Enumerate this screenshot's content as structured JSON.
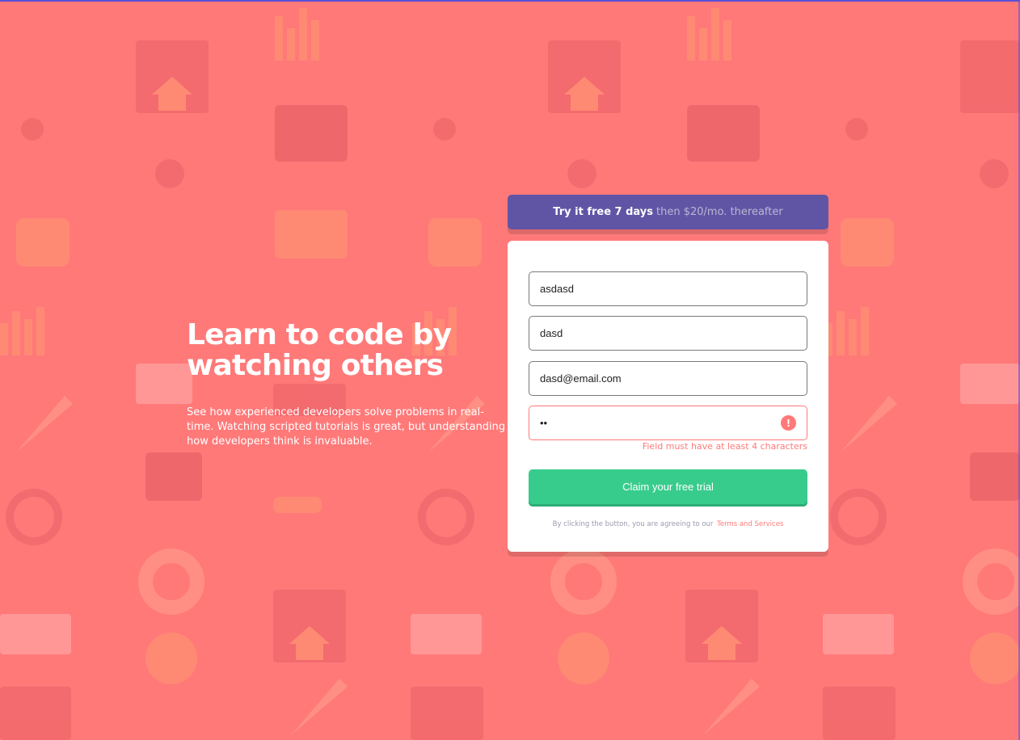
{
  "hero": {
    "title": "Learn to code by watching others",
    "description": "See how experienced developers solve problems in real-time. Watching scripted tutorials is great, but understanding how developers think is invaluable."
  },
  "promo": {
    "strong": "Try it free 7 days",
    "light": "then $20/mo. thereafter"
  },
  "form": {
    "fields": [
      {
        "name": "first-name",
        "value": "asdasd",
        "type": "text"
      },
      {
        "name": "last-name",
        "value": "dasd",
        "type": "text"
      },
      {
        "name": "email",
        "value": "dasd@email.com",
        "type": "email"
      },
      {
        "name": "password",
        "value": "••",
        "type": "password",
        "error": true
      }
    ],
    "error_icon": "!",
    "error_message": "Field must have at least 4 characters",
    "submit_label": "Claim your free trial",
    "terms_text": "By clicking the button, you are agreeing to our",
    "terms_link": "Terms and Services"
  },
  "colors": {
    "background": "#ff7979",
    "promo": "#6055a5",
    "accent_green": "#38cc8c",
    "error": "#ff7979"
  },
  "icons": [
    "background-pattern-icon",
    "alert-icon"
  ]
}
